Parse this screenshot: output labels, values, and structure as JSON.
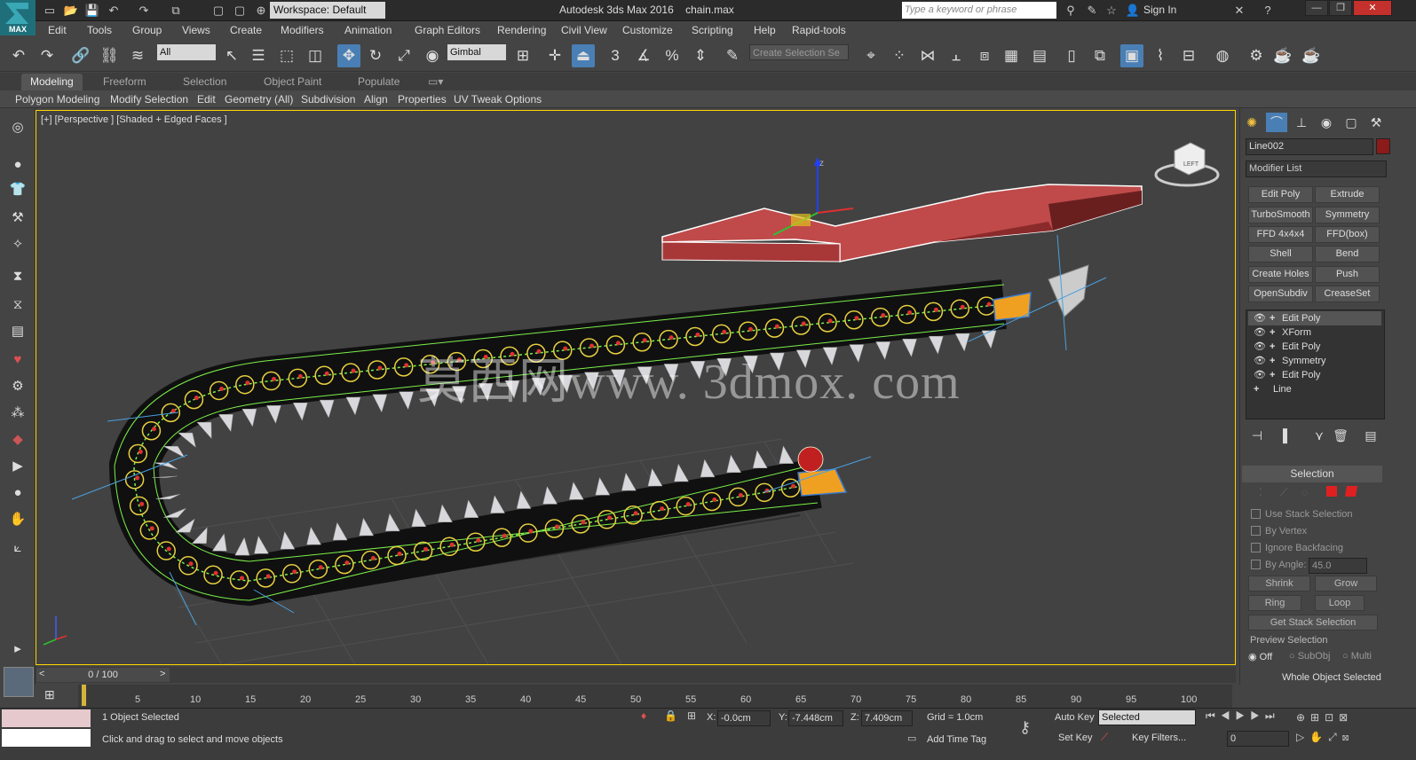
{
  "app": {
    "logo_text": "MAX",
    "title": "Autodesk 3ds Max 2016",
    "filename": "chain.max",
    "workspace": "Workspace: Default",
    "search_placeholder": "Type a keyword or phrase",
    "sign_in": "Sign In"
  },
  "menu": [
    "Edit",
    "Tools",
    "Group",
    "Views",
    "Create",
    "Modifiers",
    "Animation",
    "Graph Editors",
    "Rendering",
    "Civil View",
    "Customize",
    "Scripting",
    "Help",
    "Rapid-tools"
  ],
  "toolbar": {
    "filter": "All",
    "coord_system": "Gimbal",
    "selection_set_placeholder": "Create Selection Se",
    "snap_number": "3"
  },
  "ribbon": {
    "tabs": [
      "Modeling",
      "Freeform",
      "Selection",
      "Object Paint",
      "Populate"
    ],
    "sub_items": [
      "Polygon Modeling",
      "Modify Selection",
      "Edit",
      "Geometry (All)",
      "Subdivision",
      "Align",
      "Properties",
      "UV Tweak Options"
    ]
  },
  "viewport": {
    "label": "[+] [Perspective ] [Shaded + Edged Faces ]",
    "watermark": "莫西网www. 3dmox. com",
    "viewcube_label": "LEFT",
    "gizmo_axis": "z"
  },
  "command_panel": {
    "object_name": "Line002",
    "object_color": "#8b1a1a",
    "modifier_list": "Modifier List",
    "modifier_buttons": [
      "Edit Poly",
      "Extrude",
      "TurboSmooth",
      "Symmetry",
      "FFD 4x4x4",
      "FFD(box)",
      "Shell",
      "Bend",
      "Create Holes",
      "Push",
      "OpenSubdiv",
      "CreaseSet"
    ],
    "stack": [
      "Edit Poly",
      "XForm",
      "Edit Poly",
      "Symmetry",
      "Edit Poly",
      "Line"
    ],
    "selection": {
      "title": "Selection",
      "use_stack": "Use Stack Selection",
      "by_vertex": "By Vertex",
      "ignore_backfacing": "Ignore Backfacing",
      "by_angle": "By Angle:",
      "angle_value": "45.0",
      "shrink": "Shrink",
      "grow": "Grow",
      "ring": "Ring",
      "loop": "Loop",
      "get_stack": "Get Stack Selection",
      "preview": "Preview Selection",
      "off": "Off",
      "subobj": "SubObj",
      "multi": "Multi",
      "whole": "Whole Object Selected"
    }
  },
  "timeline": {
    "frame": "0 / 100",
    "ticks": [
      "5",
      "10",
      "15",
      "20",
      "25",
      "30",
      "35",
      "40",
      "45",
      "50",
      "55",
      "60",
      "65",
      "70",
      "75",
      "80",
      "85",
      "90",
      "95",
      "100"
    ]
  },
  "status": {
    "selected": "1 Object Selected",
    "hint": "Click and drag to select and move objects",
    "x_label": "X:",
    "x_value": "-0.0cm",
    "y_label": "Y:",
    "y_value": "-7.448cm",
    "z_label": "Z:",
    "z_value": "7.409cm",
    "grid": "Grid = 1.0cm",
    "auto_key": "Auto Key",
    "key_mode": "Selected",
    "set_key": "Set Key",
    "key_filters": "Key Filters...",
    "add_time_tag": "Add Time Tag",
    "current_frame": "0"
  }
}
